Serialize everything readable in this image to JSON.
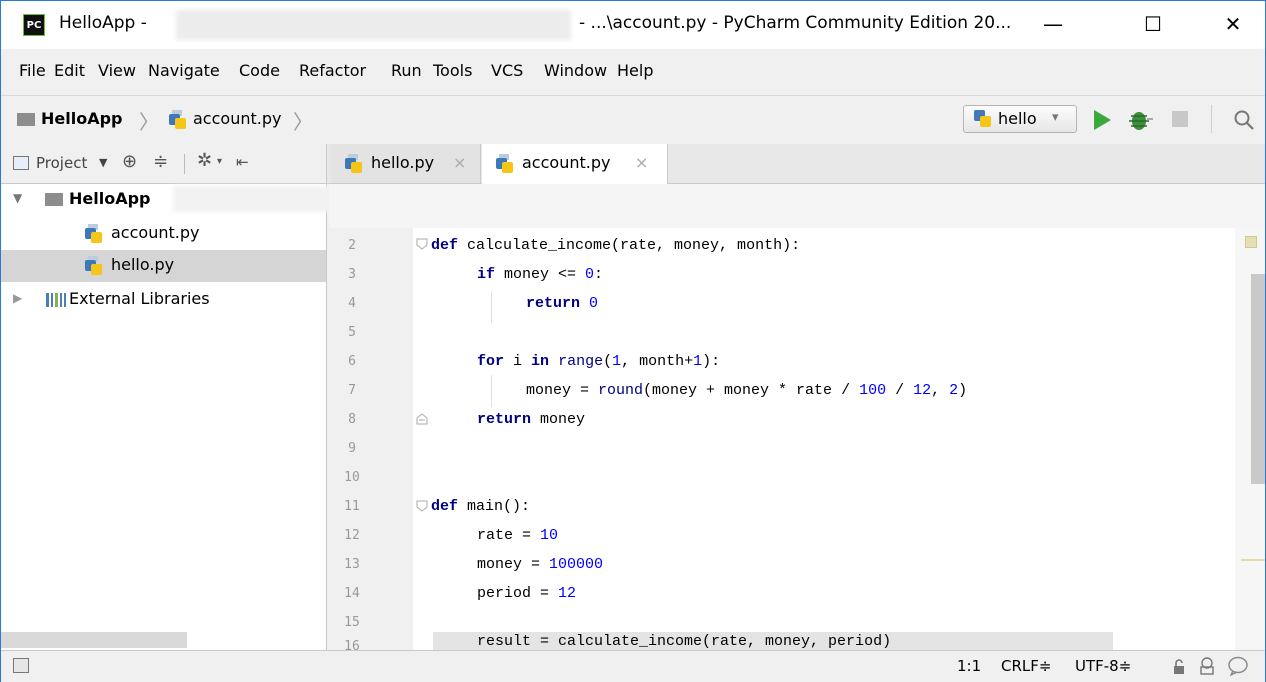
{
  "window": {
    "title_left": "HelloApp -",
    "title_right": "- ...\\account.py - PyCharm Community Edition 20...",
    "app_icon": "PC",
    "minimize": "—",
    "maximize": "☐",
    "close": "✕"
  },
  "menu": [
    {
      "label": "File"
    },
    {
      "label": "Edit"
    },
    {
      "label": "View"
    },
    {
      "label": "Navigate"
    },
    {
      "label": "Code"
    },
    {
      "label": "Refactor"
    },
    {
      "label": "Run"
    },
    {
      "label": "Tools"
    },
    {
      "label": "VCS"
    },
    {
      "label": "Window"
    },
    {
      "label": "Help"
    }
  ],
  "breadcrumb": {
    "project": "HelloApp",
    "file": "account.py"
  },
  "run_config": {
    "label": "hello",
    "arrow": "▾"
  },
  "project_panel": {
    "label": "Project",
    "arrow": "▼"
  },
  "tabs": [
    {
      "label": "hello.py",
      "close": "×",
      "active": false
    },
    {
      "label": "account.py",
      "close": "×",
      "active": true
    }
  ],
  "tree": {
    "root": {
      "label": "HelloApp",
      "arrow": "▼"
    },
    "children": [
      {
        "label": "account.py",
        "selected": false
      },
      {
        "label": "hello.py",
        "selected": true
      }
    ],
    "external": {
      "label": "External Libraries",
      "arrow": "▶"
    }
  },
  "code_lines": [
    {
      "n": "2"
    },
    {
      "n": "3"
    },
    {
      "n": "4"
    },
    {
      "n": "5"
    },
    {
      "n": "6"
    },
    {
      "n": "7"
    },
    {
      "n": "8"
    },
    {
      "n": "9"
    },
    {
      "n": "10"
    },
    {
      "n": "11"
    },
    {
      "n": "12"
    },
    {
      "n": "13"
    },
    {
      "n": "14"
    },
    {
      "n": "15"
    },
    {
      "n": "16"
    }
  ],
  "code": {
    "l2_kw": "def",
    "l2_rest": " calculate_income(rate, money, month):",
    "l3_kw": "if",
    "l3_rest": " money <= ",
    "l3_num": "0",
    "l3_end": ":",
    "l4_kw": "return",
    "l4_num": "0",
    "l6_kw1": "for",
    "l6_a": " i ",
    "l6_kw2": "in",
    "l6_b": " ",
    "l6_bi": "range",
    "l6_c": "(",
    "l6_n1": "1",
    "l6_d": ", month+",
    "l6_n2": "1",
    "l6_e": "):",
    "l7_a": "money = ",
    "l7_bi": "round",
    "l7_b": "(money + money * rate / ",
    "l7_n1": "100",
    "l7_c": " / ",
    "l7_n2": "12",
    "l7_d": ", ",
    "l7_n3": "2",
    "l7_e": ")",
    "l8_kw": "return",
    "l8_rest": " money",
    "l11_kw": "def",
    "l11_rest": " main():",
    "l12_a": "rate = ",
    "l12_n": "10",
    "l13_a": "money = ",
    "l13_n": "100000",
    "l14_a": "period = ",
    "l14_n": "12",
    "l16_a": "result = calculate_income(rate, money, period)"
  },
  "status": {
    "position": "1:1",
    "line_sep": "CRLF≑",
    "encoding": "UTF-8≑"
  },
  "colors": {
    "keyword": "#000080",
    "number": "#0000ff",
    "run_green": "#3aa83a"
  }
}
